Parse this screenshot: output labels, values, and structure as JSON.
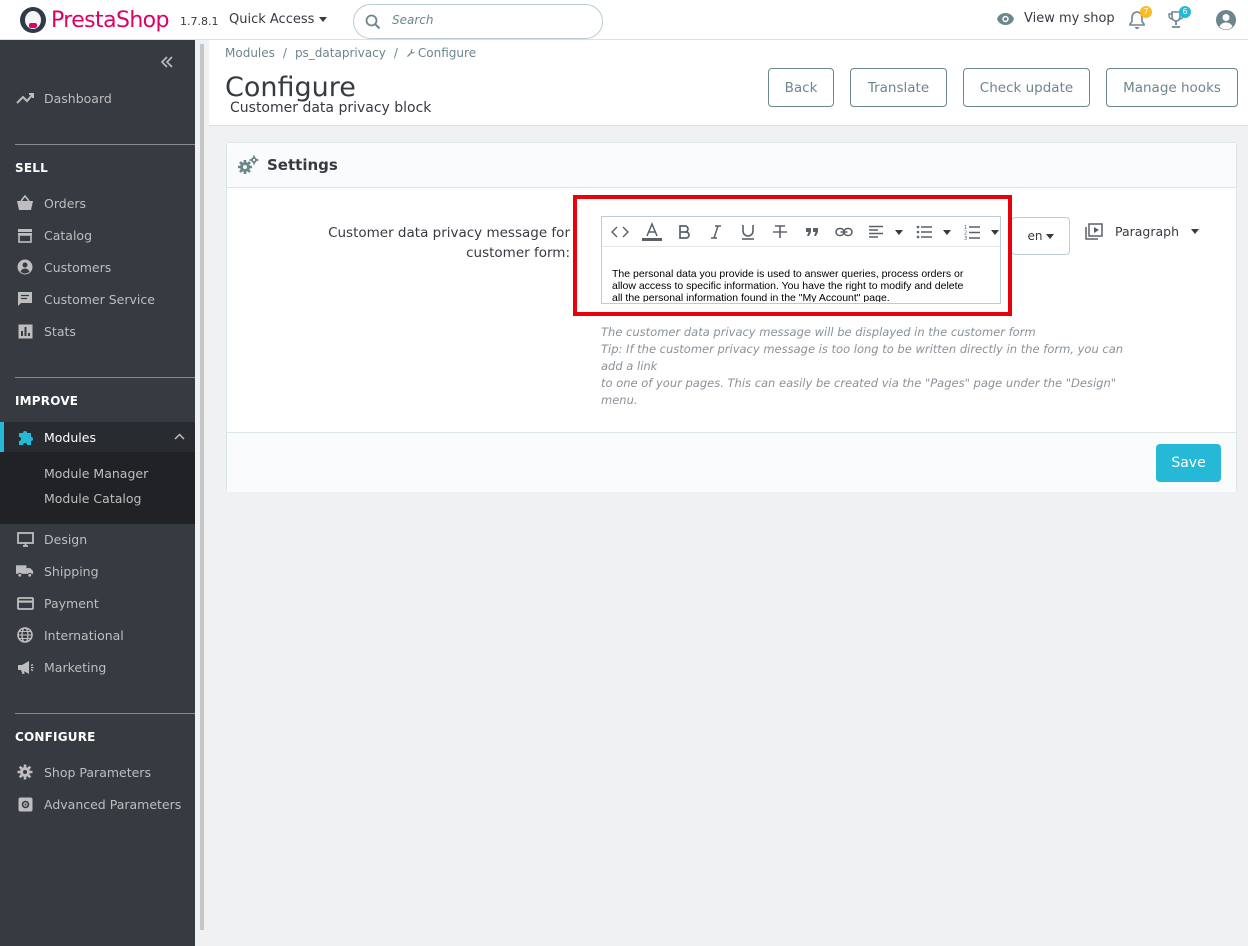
{
  "header": {
    "brand_presta": "Presta",
    "brand_shop": "Shop",
    "version": "1.7.8.1",
    "quick_access": "Quick Access",
    "search_placeholder": "Search",
    "view_shop": "View my shop",
    "notifications_count": "7",
    "trophy_count": "6",
    "notification_color": "#fbbb22",
    "trophy_color": "#25b9d7"
  },
  "sidebar": {
    "dashboard": "Dashboard",
    "sell_title": "SELL",
    "sell_items": [
      "Orders",
      "Catalog",
      "Customers",
      "Customer Service",
      "Stats"
    ],
    "improve_title": "IMPROVE",
    "modules": "Modules",
    "module_sub": [
      "Module Manager",
      "Module Catalog"
    ],
    "improve_items": [
      "Design",
      "Shipping",
      "Payment",
      "International",
      "Marketing"
    ],
    "configure_title": "CONFIGURE",
    "configure_items": [
      "Shop Parameters",
      "Advanced Parameters"
    ],
    "accent_color": "#25b9d7"
  },
  "breadcrumb": [
    "Modules",
    "ps_dataprivacy",
    "Configure"
  ],
  "page": {
    "title": "Configure",
    "subtitle": "Customer data privacy block",
    "buttons": [
      "Back",
      "Translate",
      "Check update",
      "Manage hooks"
    ]
  },
  "panel": {
    "title": "Settings",
    "label_line1": "Customer data privacy message for",
    "label_line2": "customer form:",
    "editor_text_1": "The personal data you provide is used to answer queries, process orders or",
    "editor_text_2": "allow access to specific information. You have the right to modify and delete",
    "editor_text_3": "all the personal information found in the \"My Account\" page.",
    "language": "en",
    "paragraph": "Paragraph",
    "help_1": "The customer data privacy message will be displayed in the customer form",
    "help_2": "Tip: If the customer privacy message is too long to be written directly in the form, you can add a link",
    "help_3": "to one of your pages. This can easily be created via the \"Pages\" page under the \"Design\" menu.",
    "save": "Save",
    "highlight_color": "#e8000b"
  }
}
